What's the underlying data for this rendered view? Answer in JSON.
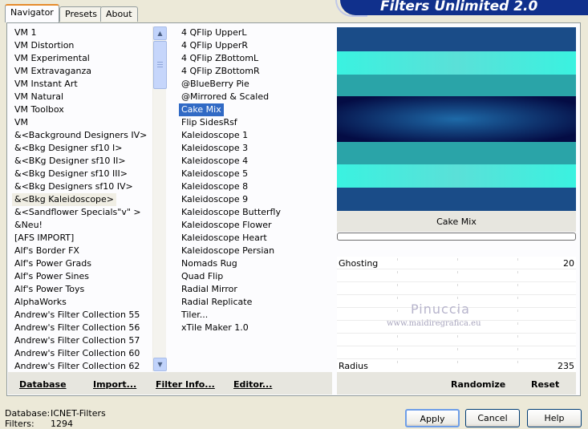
{
  "tabs": [
    "Navigator",
    "Presets",
    "About"
  ],
  "banner_title": "Filters Unlimited 2.0",
  "categories": [
    "VM 1",
    "VM Distortion",
    "VM Experimental",
    "VM Extravaganza",
    "VM Instant Art",
    "VM Natural",
    "VM Toolbox",
    "VM",
    "&<Background Designers IV>",
    "&<Bkg Designer sf10 I>",
    "&<BKg Designer sf10 II>",
    "&<Bkg Designer sf10 III>",
    "&<Bkg Designers sf10 IV>",
    "&<Bkg Kaleidoscope>",
    "&<Sandflower Specials\"v\" >",
    "&Neu!",
    "[AFS IMPORT]",
    "Alf's Border FX",
    "Alf's Power Grads",
    "Alf's Power Sines",
    "Alf's Power Toys",
    "AlphaWorks",
    "Andrew's Filter Collection 55",
    "Andrew's Filter Collection 56",
    "Andrew's Filter Collection 57",
    "Andrew's Filter Collection 60",
    "Andrew's Filter Collection 62"
  ],
  "filters": [
    "4 QFlip UpperL",
    "4 QFlip UpperR",
    "4 QFlip ZBottomL",
    "4 QFlip ZBottomR",
    "@BlueBerry Pie",
    "@Mirrored & Scaled",
    "Cake Mix",
    "Flip SidesRsf",
    "Kaleidoscope 1",
    "Kaleidoscope 3",
    "Kaleidoscope 4",
    "Kaleidoscope 5",
    "Kaleidoscope 8",
    "Kaleidoscope 9",
    "Kaleidoscope Butterfly",
    "Kaleidoscope Flower",
    "Kaleidoscope Heart",
    "Kaleidoscope Persian",
    "Nomads Rug",
    "Quad Flip",
    "Radial Mirror",
    "Radial Replicate",
    "Tiler...",
    "xTile Maker 1.0"
  ],
  "selected_category_index": 13,
  "selected_filter_index": 6,
  "preview_caption": "Cake Mix",
  "preview_colors": [
    "#1a4c88",
    "#33e8d8",
    "#2aa4a8",
    "#06124c",
    "#2aa4a8",
    "#33e8d8",
    "#1a4c88"
  ],
  "sliders": {
    "ghosting_label": "Ghosting",
    "ghosting_value": "20",
    "radius_label": "Radius",
    "radius_value": "235"
  },
  "watermark": {
    "name": "Pinuccia",
    "url": "www.maidiregrafica.eu"
  },
  "bottom_buttons": [
    "Database",
    "Import...",
    "Filter Info...",
    "Editor..."
  ],
  "action_buttons": [
    "Randomize",
    "Reset"
  ],
  "status": {
    "database_label": "Database:",
    "database_value": "ICNET-Filters",
    "filters_label": "Filters:",
    "filters_value": "1294"
  },
  "dialog_buttons": [
    "Apply",
    "Cancel",
    "Help"
  ]
}
